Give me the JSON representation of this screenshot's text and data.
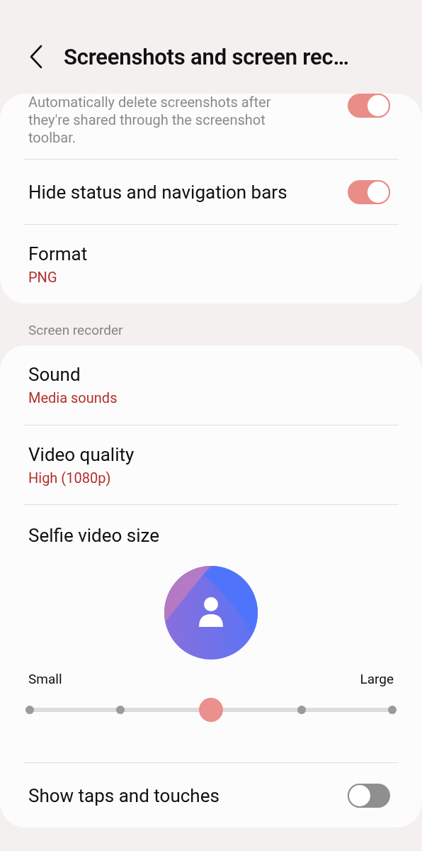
{
  "header": {
    "title": "Screenshots and screen rec…"
  },
  "groups": [
    {
      "rows": [
        {
          "kind": "toggle",
          "description": "Automatically delete screenshots after they're shared through the screenshot toolbar.",
          "on": true
        },
        {
          "kind": "toggle",
          "title": "Hide status and navigation bars",
          "on": true
        },
        {
          "kind": "value",
          "title": "Format",
          "value": "PNG"
        }
      ]
    },
    {
      "heading": "Screen recorder",
      "rows": [
        {
          "kind": "value",
          "title": "Sound",
          "value": "Media sounds"
        },
        {
          "kind": "value",
          "title": "Video quality",
          "value": "High (1080p)"
        },
        {
          "kind": "size",
          "title": "Selfie video size",
          "min_label": "Small",
          "max_label": "Large",
          "level": 0.5
        },
        {
          "kind": "toggle",
          "title": "Show taps and touches",
          "on": false
        }
      ]
    }
  ]
}
